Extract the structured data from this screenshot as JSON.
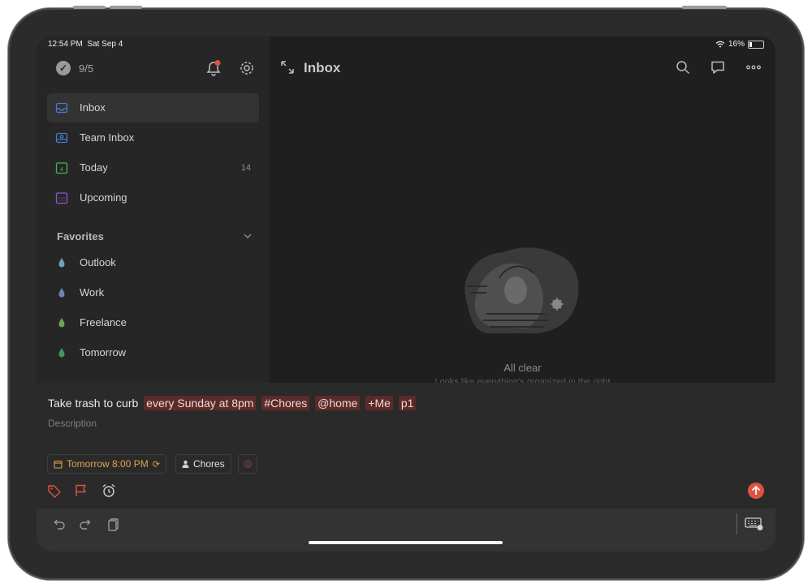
{
  "status_bar": {
    "time": "12:54 PM",
    "date": "Sat Sep 4",
    "battery": "16%"
  },
  "sidebar": {
    "karma_label": "9/5",
    "nav": [
      {
        "label": "Inbox",
        "count": "",
        "icon": "inbox-icon",
        "color": "#4a7bd0"
      },
      {
        "label": "Team Inbox",
        "count": "",
        "icon": "team-inbox-icon",
        "color": "#4a7bd0"
      },
      {
        "label": "Today",
        "count": "14",
        "icon": "calendar-today-icon",
        "color": "#4caf50"
      },
      {
        "label": "Upcoming",
        "count": "",
        "icon": "calendar-upcoming-icon",
        "color": "#8a5cc7"
      }
    ],
    "favorites_title": "Favorites",
    "favorites": [
      {
        "label": "Outlook",
        "color": "#6aa5b8"
      },
      {
        "label": "Work",
        "color": "#6b87b8"
      },
      {
        "label": "Freelance",
        "color": "#6ea35a"
      },
      {
        "label": "Tomorrow",
        "color": "#3e9b5b"
      }
    ]
  },
  "main": {
    "title": "Inbox",
    "empty_title": "All clear",
    "empty_subtitle": "Looks like everything's organized in the right"
  },
  "composer": {
    "task_text": "Take trash to curb",
    "chips": [
      "every Sunday at 8pm",
      "#Chores",
      "@home",
      "+Me",
      "p1"
    ],
    "description_placeholder": "Description",
    "date_label": "Tomorrow 8:00 PM",
    "project_label": "Chores"
  },
  "colors": {
    "accent": "#e0523f",
    "date": "#e0a24a"
  }
}
